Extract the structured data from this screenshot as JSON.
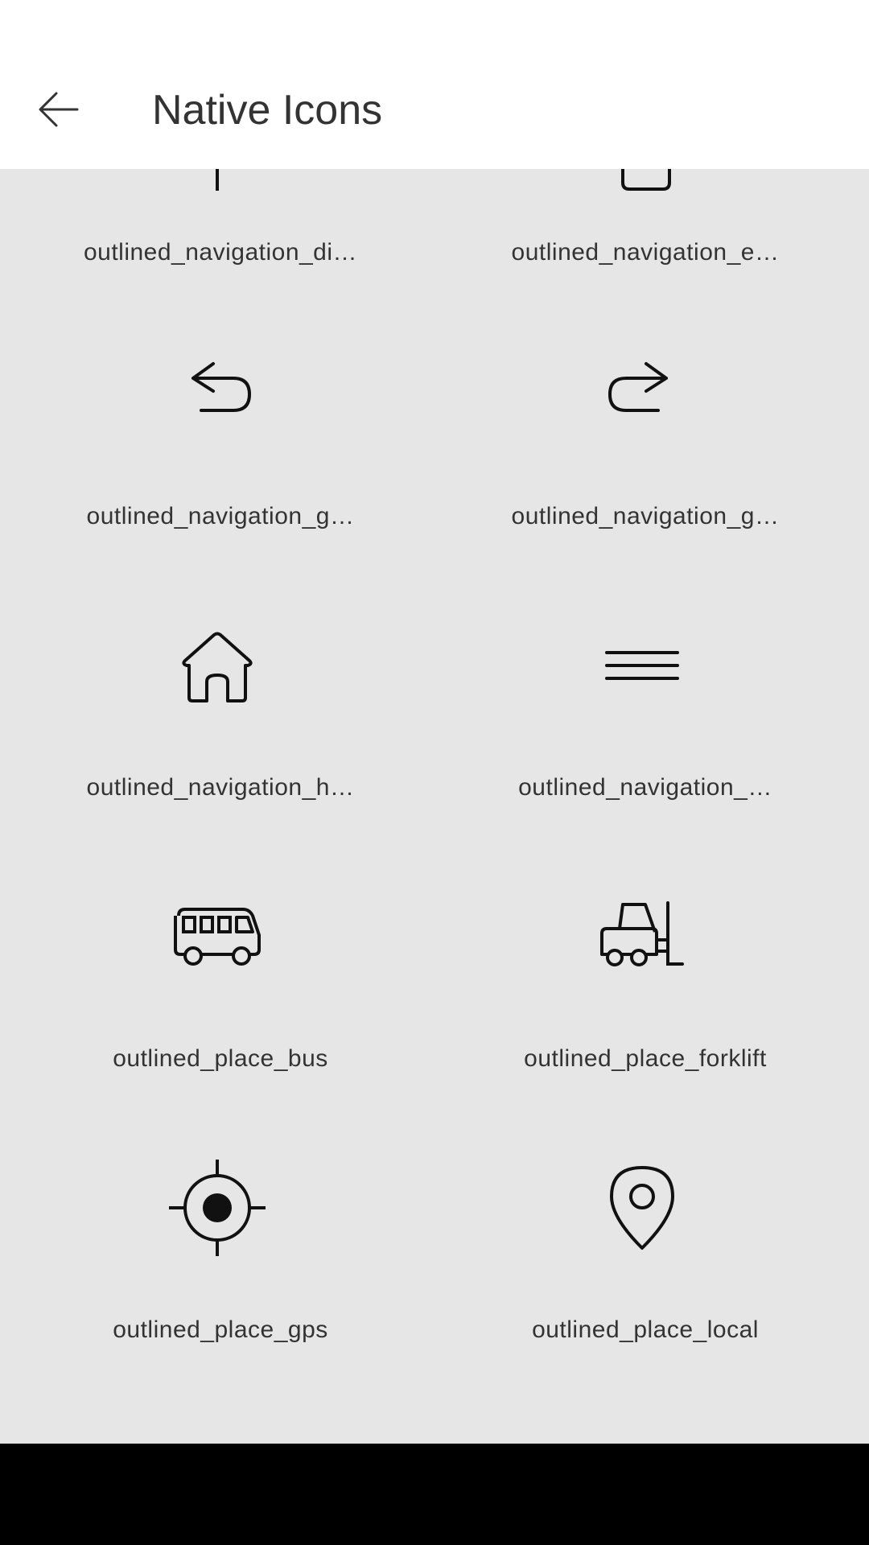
{
  "header": {
    "title": "Native Icons"
  },
  "icons": [
    {
      "label": "outlined_navigation_di…",
      "icon": "navigation-direction-icon"
    },
    {
      "label": "outlined_navigation_e…",
      "icon": "navigation-exit-icon"
    },
    {
      "label": "outlined_navigation_g…",
      "icon": "navigation-go-back-icon"
    },
    {
      "label": "outlined_navigation_g…",
      "icon": "navigation-go-forward-icon"
    },
    {
      "label": "outlined_navigation_h…",
      "icon": "navigation-home-icon"
    },
    {
      "label": "outlined_navigation_…",
      "icon": "navigation-menu-icon"
    },
    {
      "label": "outlined_place_bus",
      "icon": "bus-icon"
    },
    {
      "label": "outlined_place_forklift",
      "icon": "forklift-icon"
    },
    {
      "label": "outlined_place_gps",
      "icon": "gps-icon"
    },
    {
      "label": "outlined_place_local",
      "icon": "location-pin-icon"
    }
  ]
}
